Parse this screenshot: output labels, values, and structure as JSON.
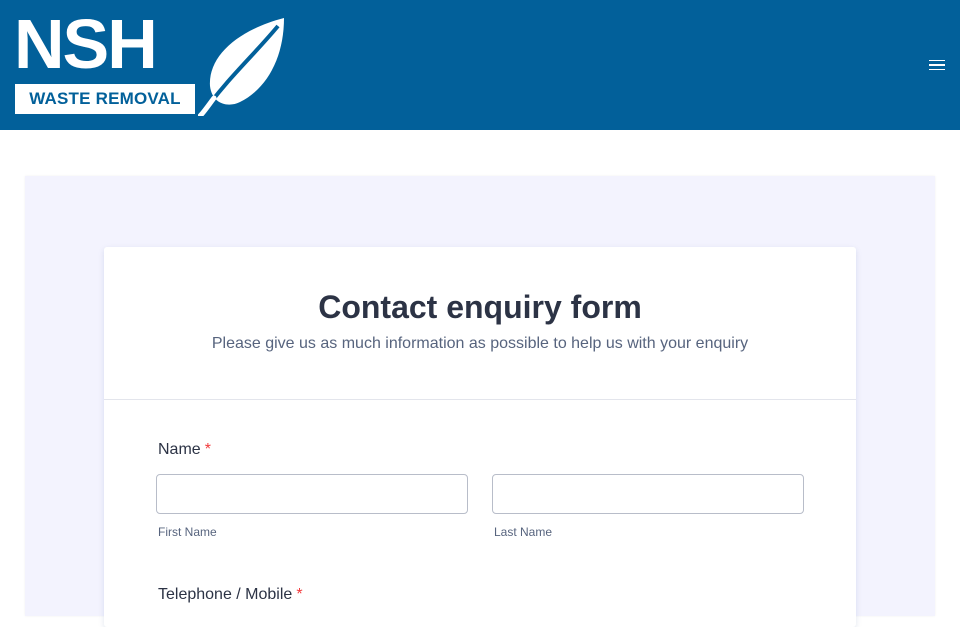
{
  "header": {
    "logo": {
      "brand": "NSH",
      "subtitle": "WASTE REMOVAL",
      "icon": "leaf-icon"
    },
    "menu_icon": "hamburger-menu-icon",
    "background_color": "#02609a"
  },
  "form": {
    "title": "Contact enquiry form",
    "subtitle": "Please give us as much information as possible to help us with your enquiry",
    "fields": {
      "name": {
        "label": "Name",
        "required_marker": "*",
        "first_name": {
          "value": "",
          "sublabel": "First Name"
        },
        "last_name": {
          "value": "",
          "sublabel": "Last Name"
        }
      },
      "telephone": {
        "label": "Telephone / Mobile",
        "required_marker": "*"
      }
    }
  },
  "colors": {
    "page_background": "#f3f3fe",
    "required": "#f23a3c",
    "text": "#2c3345"
  }
}
